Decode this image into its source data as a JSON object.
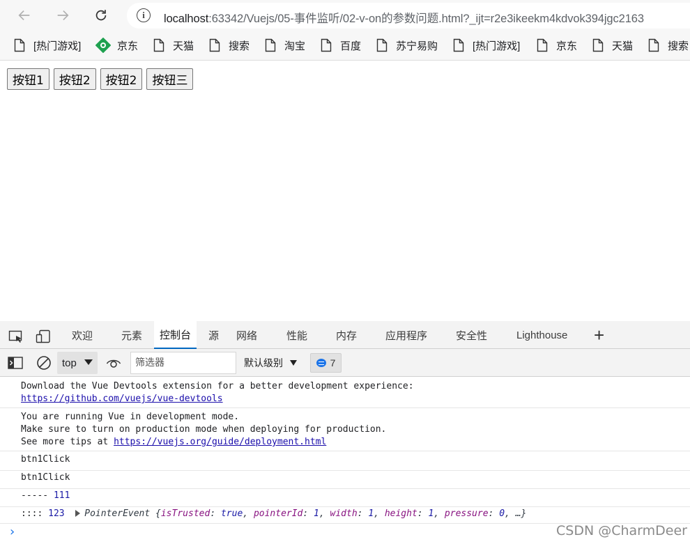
{
  "browser": {
    "url_host": "localhost",
    "url_rest": ":63342/Vuejs/05-事件监听/02-v-on的参数问题.html?_ijt=r2e3ikeekm4kdvok394jgc2163"
  },
  "bookmarks": [
    {
      "label": "[热门游戏]",
      "icon": "page-icon"
    },
    {
      "label": "京东",
      "icon": "jd-icon"
    },
    {
      "label": "天猫",
      "icon": "page-icon"
    },
    {
      "label": "搜索",
      "icon": "page-icon"
    },
    {
      "label": "淘宝",
      "icon": "page-icon"
    },
    {
      "label": "百度",
      "icon": "page-icon"
    },
    {
      "label": "苏宁易购",
      "icon": "page-icon"
    },
    {
      "label": "[热门游戏]",
      "icon": "page-icon"
    },
    {
      "label": "京东",
      "icon": "page-icon"
    },
    {
      "label": "天猫",
      "icon": "page-icon"
    },
    {
      "label": "搜索",
      "icon": "page-icon"
    }
  ],
  "page": {
    "buttons": [
      "按钮1",
      "按钮2",
      "按钮2",
      "按钮三"
    ]
  },
  "devtools": {
    "tabs": [
      "欢迎",
      "元素",
      "控制台",
      "源",
      "网络",
      "性能",
      "内存",
      "应用程序",
      "安全性",
      "Lighthouse"
    ],
    "active_tab": "控制台",
    "context": "top",
    "filter_placeholder": "筛选器",
    "level": "默认级别",
    "message_count": "7"
  },
  "console": {
    "msg1_text": "Download the Vue Devtools extension for a better development experience:",
    "msg1_link": "https://github.com/vuejs/vue-devtools",
    "msg2_line1": "You are running Vue in development mode.",
    "msg2_line2": "Make sure to turn on production mode when deploying for production.",
    "msg2_line3_prefix": "See more tips at ",
    "msg2_link": "https://vuejs.org/guide/deployment.html",
    "msg3": "btn1Click",
    "msg4": "btn1Click",
    "msg5_prefix": "----- ",
    "msg5_value": "111",
    "msg6_prefix": ":::: ",
    "msg6_value": "123",
    "msg6_object_name": "PointerEvent",
    "msg6_props": [
      {
        "key": "isTrusted",
        "value": "true"
      },
      {
        "key": "pointerId",
        "value": "1"
      },
      {
        "key": "width",
        "value": "1"
      },
      {
        "key": "height",
        "value": "1"
      },
      {
        "key": "pressure",
        "value": "0"
      }
    ],
    "msg6_ellipsis": "…}"
  },
  "watermark": "CSDN @CharmDeer",
  "colors": {
    "accent": "#0067c0",
    "link": "#1a0dab",
    "number": "#1a1aa6",
    "key": "#881280",
    "jd_green": "#1fa150"
  }
}
